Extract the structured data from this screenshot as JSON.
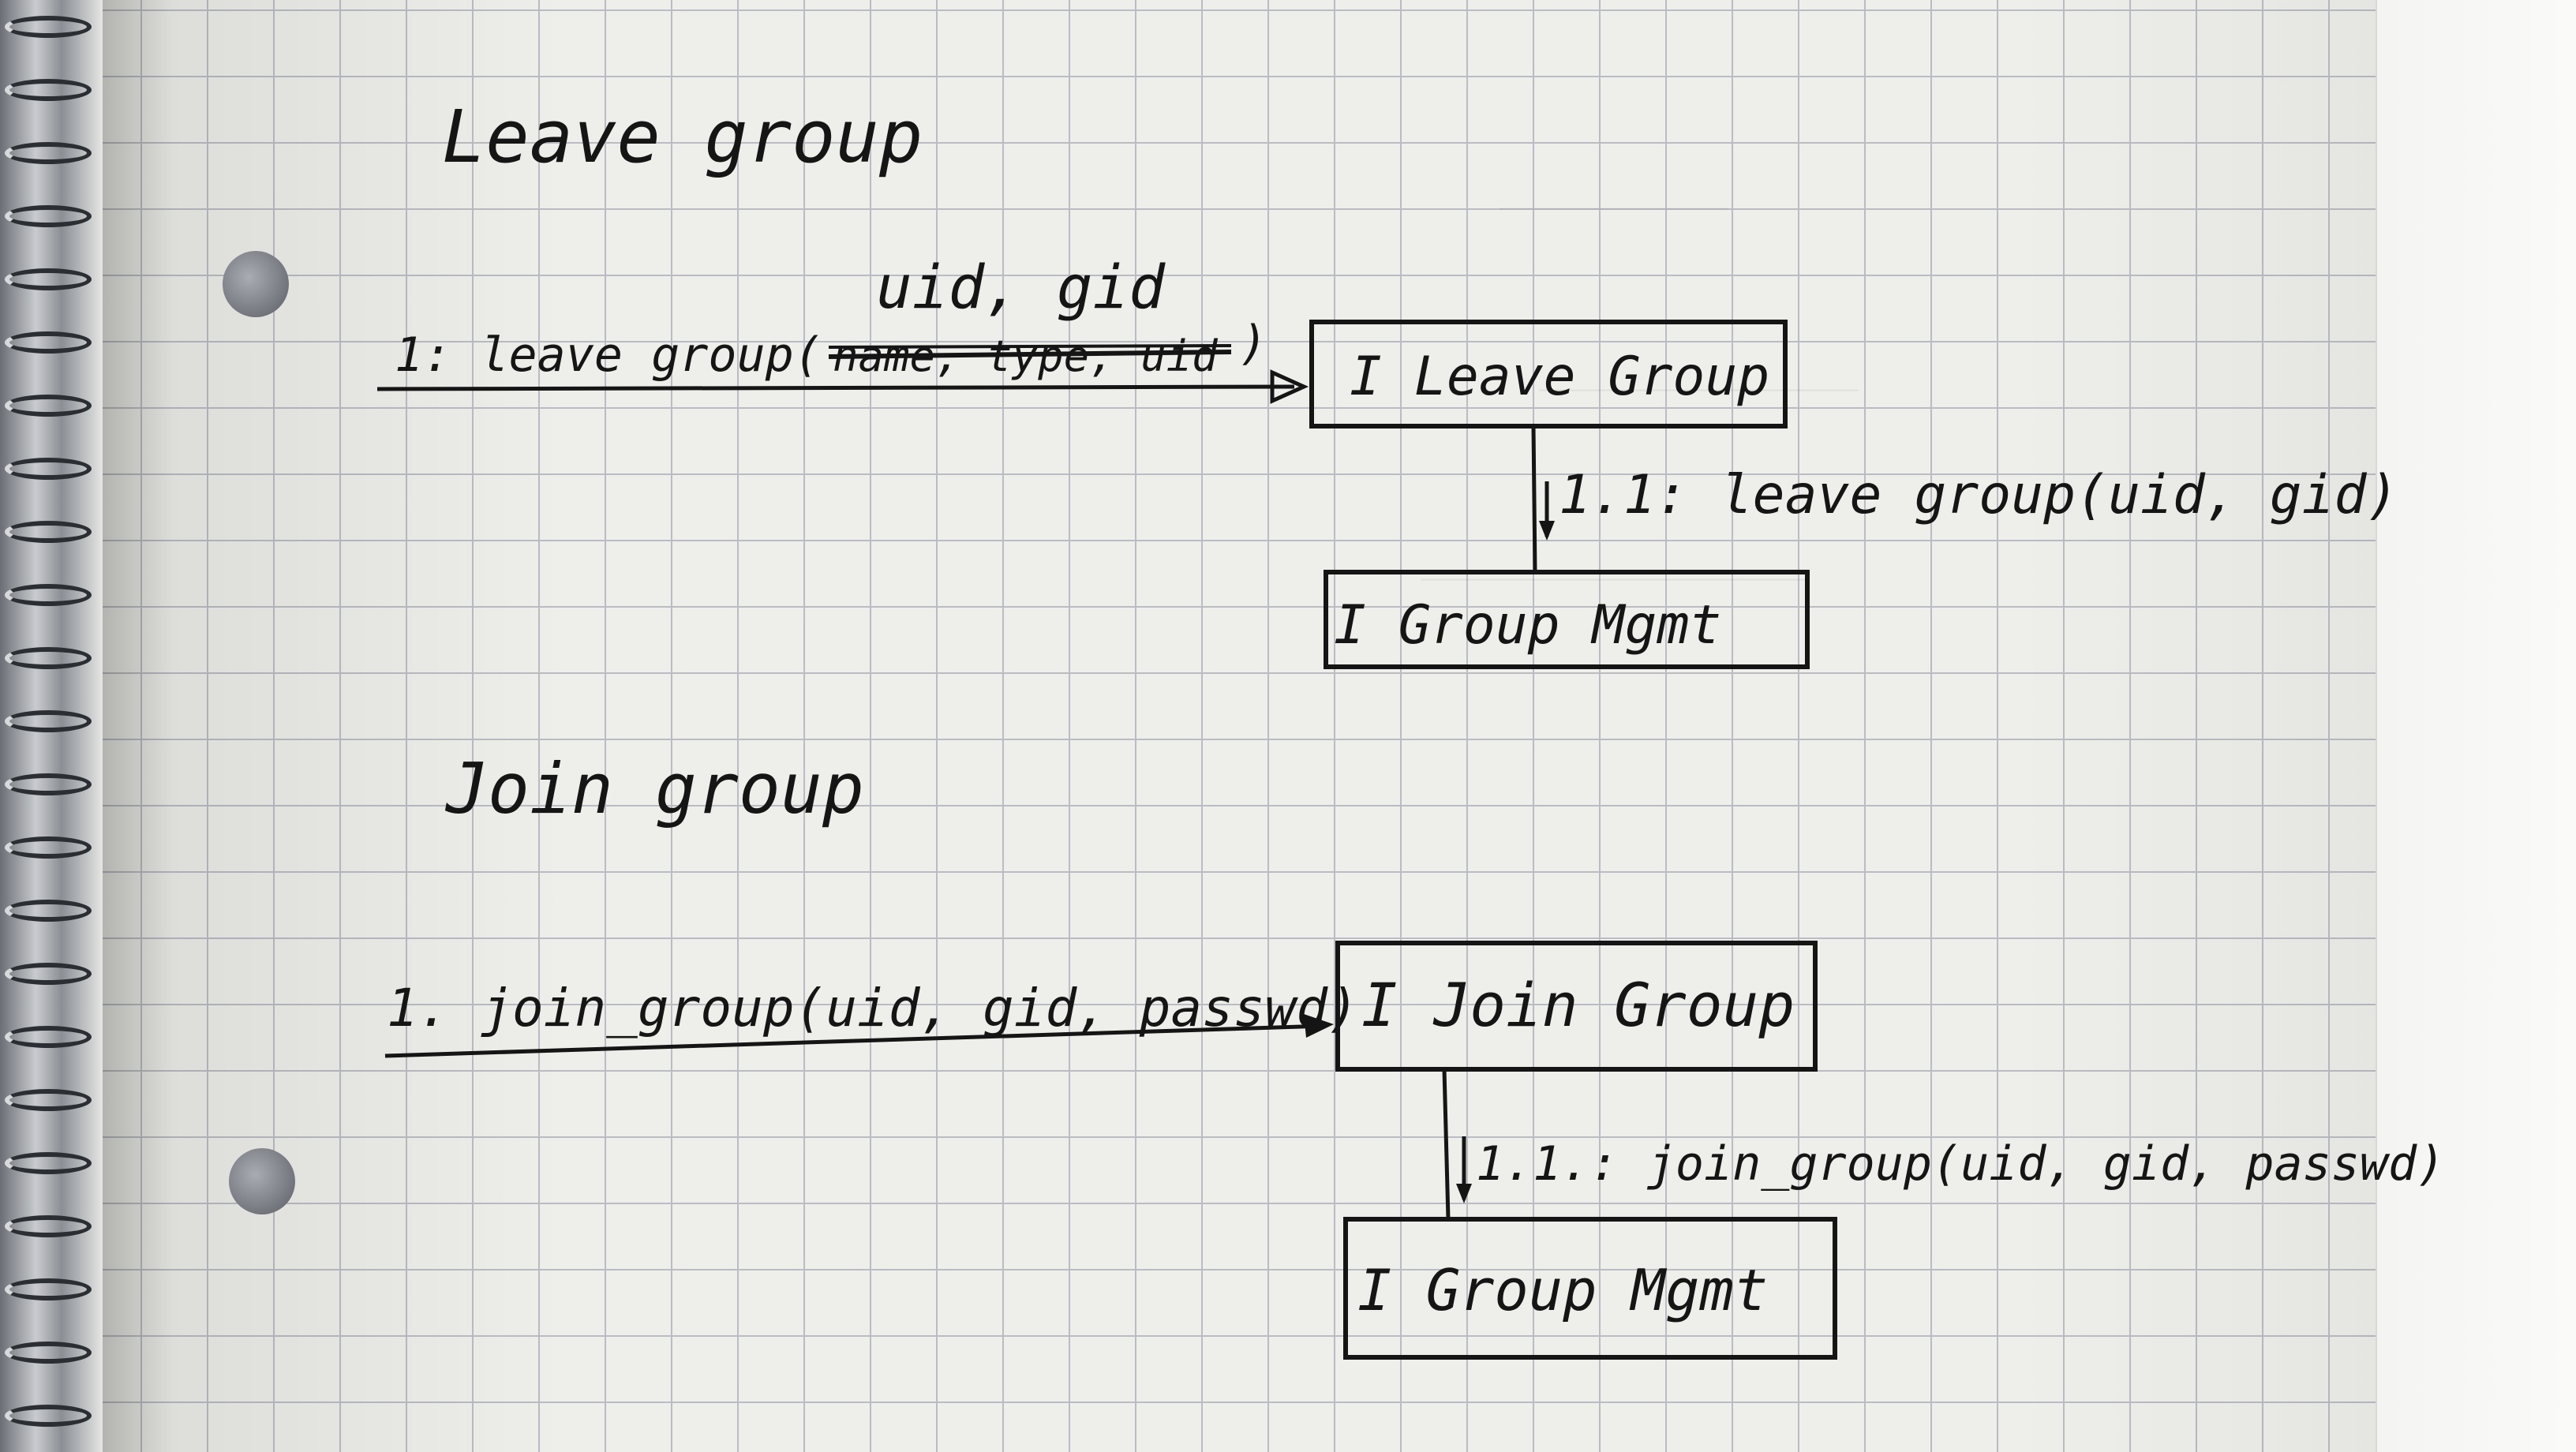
{
  "leave_section": {
    "heading": "Leave group",
    "message_1_prefix": "1: leave group(",
    "message_1_struck": "name, type, uid",
    "message_1_suffix": ")",
    "message_1_inserted_params": "uid, gid",
    "object_1": "I Leave Group",
    "message_2": "1.1: leave group(uid, gid)",
    "object_2": "I Group Mgmt"
  },
  "join_section": {
    "heading": "Join group",
    "message_1": "1. join_group(uid, gid, passwd)",
    "object_1": "I Join Group",
    "message_2": "1.1.: join_group(uid, gid, passwd)",
    "object_2": "I Group Mgmt"
  },
  "colors": {
    "ink": "#151515",
    "paper": "#eeeeea",
    "grid": "#b9bcc3"
  }
}
